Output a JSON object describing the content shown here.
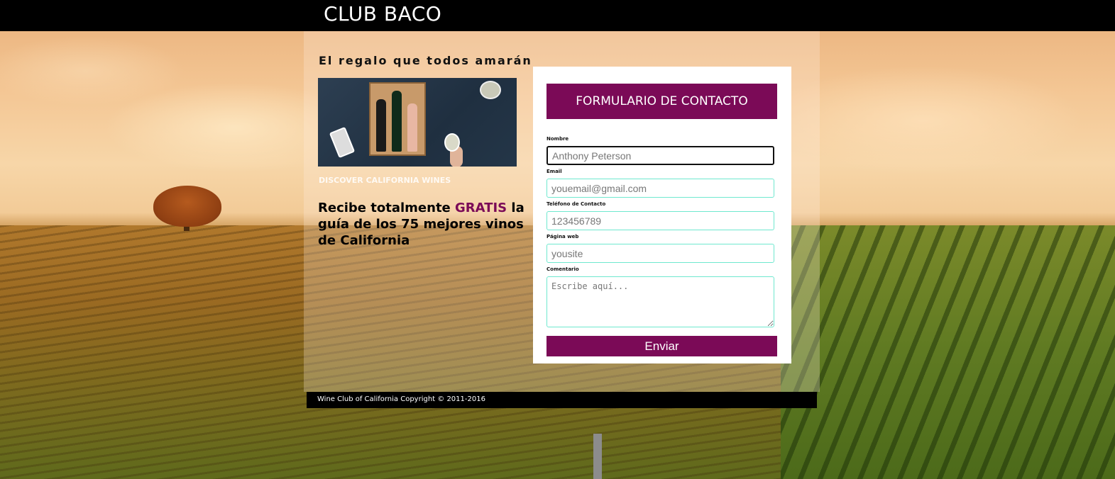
{
  "brand": "CLUB BACO",
  "hero": {
    "tagline": "El regalo que todos amarán",
    "discover_text": "DISCOVER CALIFORNIA WINES",
    "promo_prefix": "Recibe totalmente ",
    "promo_highlight": "GRATIS",
    "promo_rest": " la guía de los 75 mejores vinos de California"
  },
  "form": {
    "title": "FORMULARIO DE CONTACTO",
    "fields": {
      "name": {
        "label": "Nombre",
        "placeholder": "Anthony Peterson"
      },
      "email": {
        "label": "Email",
        "placeholder": "youemail@gmail.com"
      },
      "phone": {
        "label": "Teléfono de Contacto",
        "placeholder": "123456789"
      },
      "website": {
        "label": "Página web",
        "placeholder": "yousite"
      },
      "comment": {
        "label": "Comentario",
        "placeholder": "Escribe aquí..."
      }
    },
    "submit_label": "Enviar"
  },
  "footer": {
    "copyright": "Wine Club of California Copyright © 2011-2016"
  },
  "colors": {
    "accent": "#7b0a57",
    "input_border": "#6fe8cf",
    "topbar": "#000000"
  }
}
